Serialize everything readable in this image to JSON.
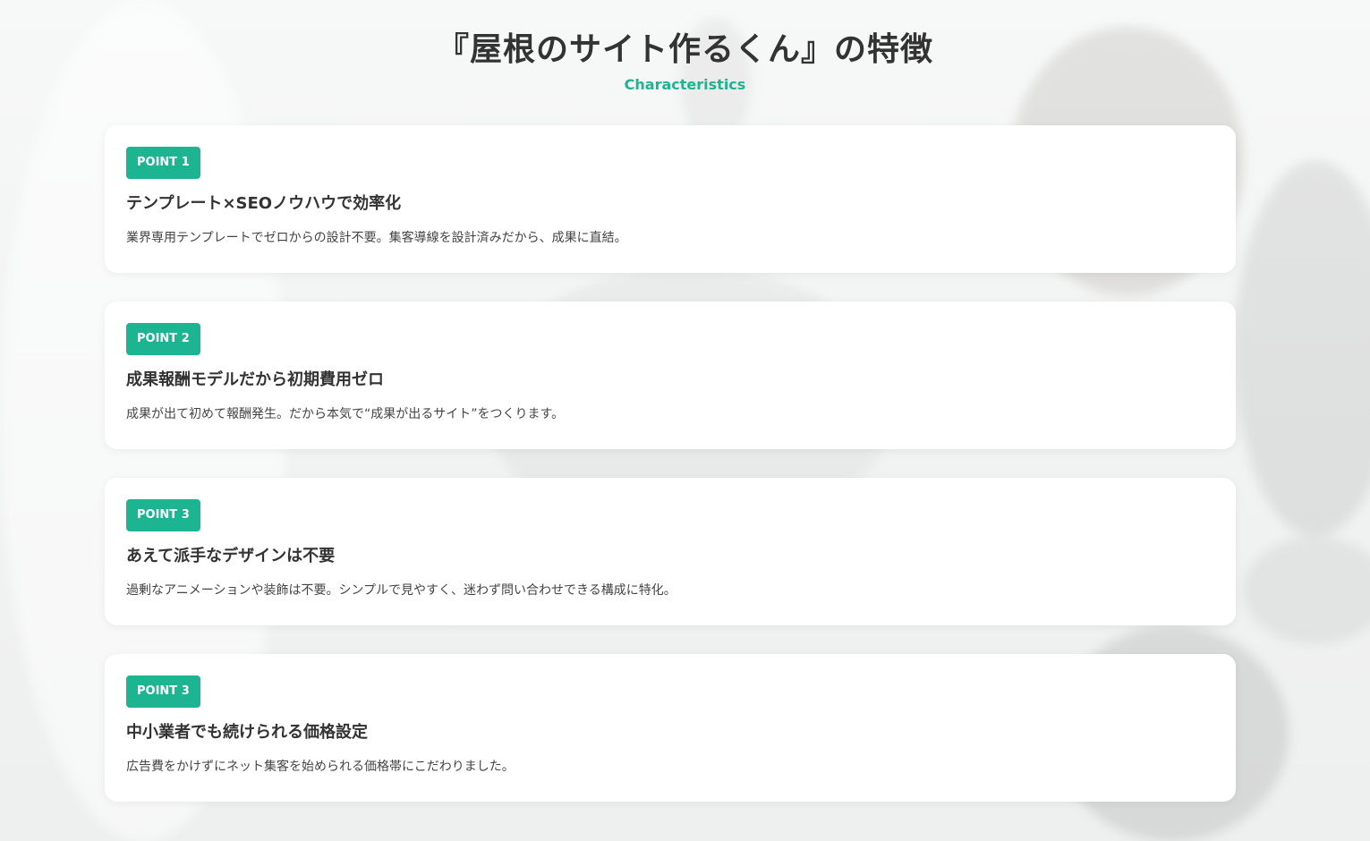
{
  "header": {
    "title": "『屋根のサイト作るくん』の特徴",
    "subtitle": "Characteristics"
  },
  "colors": {
    "accent": "#1db591",
    "text": "#333333",
    "card_bg": "#ffffff"
  },
  "points": [
    {
      "badge": "POINT 1",
      "title": "テンプレート×SEOノウハウで効率化",
      "text": "業界専用テンプレートでゼロからの設計不要。集客導線を設計済みだから、成果に直結。"
    },
    {
      "badge": "POINT 2",
      "title": "成果報酬モデルだから初期費用ゼロ",
      "text": "成果が出て初めて報酬発生。だから本気で“成果が出るサイト”をつくります。"
    },
    {
      "badge": "POINT 3",
      "title": "あえて派手なデザインは不要",
      "text": "過剰なアニメーションや装飾は不要。シンプルで見やすく、迷わず問い合わせできる構成に特化。"
    },
    {
      "badge": "POINT 3",
      "title": "中小業者でも続けられる価格設定",
      "text": "広告費をかけずにネット集客を始められる価格帯にこだわりました。"
    }
  ]
}
